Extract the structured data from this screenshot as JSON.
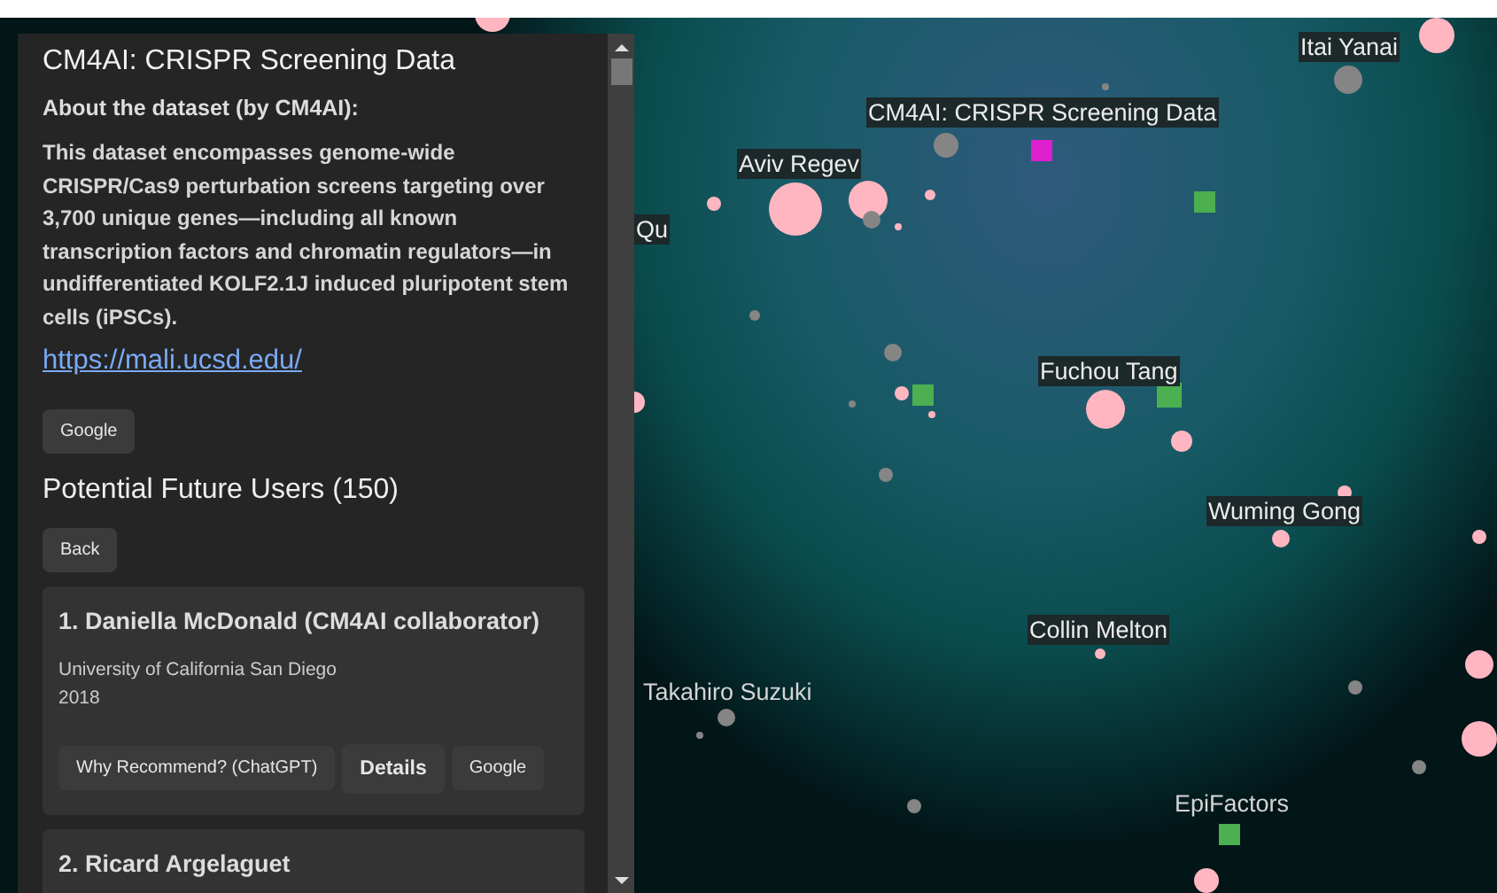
{
  "panel": {
    "title": "CM4AI: CRISPR Screening Data",
    "about_heading": "About the dataset (by CM4AI):",
    "description": "This dataset encompasses genome-wide CRISPR/Cas9 perturbation screens targeting over 3,700 unique genes—including all known transcription factors and chromatin regulators—in undifferentiated KOLF2.1J induced pluripotent stem cells (iPSCs).",
    "link": "https://mali.ucsd.edu/",
    "google_button": "Google"
  },
  "users_section": {
    "heading": "Potential Future Users (150)",
    "back_button": "Back",
    "users": [
      {
        "name": "1. Daniella McDonald (CM4AI collaborator)",
        "affiliation": "University of California San Diego",
        "year": "2018",
        "buttons": [
          {
            "label": "Why Recommend? (ChatGPT)",
            "kind": "small"
          },
          {
            "label": "Details",
            "kind": "large"
          },
          {
            "label": "Google",
            "kind": "small"
          }
        ]
      },
      {
        "name": "2. Ricard Argelaguet"
      }
    ]
  },
  "graph": {
    "labels": [
      {
        "text": "Itai Yanai",
        "highlighted": true
      },
      {
        "text": "CM4AI: CRISPR Screening Data",
        "highlighted": true
      },
      {
        "text": "Aviv Regev",
        "highlighted": true
      },
      {
        "text": "Qu",
        "highlighted": true
      },
      {
        "text": "Fuchou Tang",
        "highlighted": true
      },
      {
        "text": "Wuming Gong",
        "highlighted": true
      },
      {
        "text": "Collin Melton",
        "highlighted": true
      },
      {
        "text": "Takahiro Suzuki",
        "highlighted": false
      },
      {
        "text": "EpiFactors",
        "highlighted": false
      }
    ]
  }
}
